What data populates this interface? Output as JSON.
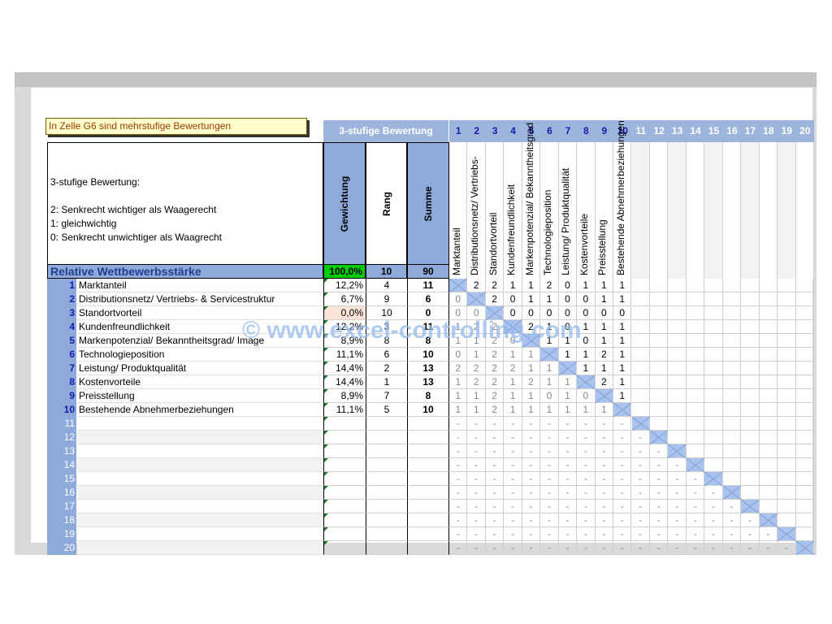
{
  "note": "In Zelle G6 sind mehrstufige Bewertungen",
  "header_label": "3-stufige Bewertung",
  "info_lines": [
    "3-stufige Bewertung:",
    "",
    "2: Senkrecht wichtiger als Waagerecht",
    "1: gleichwichtig",
    "0: Senkrecht unwichtiger als Waagrecht"
  ],
  "col_headers": {
    "weight": "Gewichtung",
    "rank": "Rang",
    "sum": "Summe"
  },
  "relative": {
    "label": "Relative Wettbewerbsstärke",
    "weight": "100,0%",
    "rank": "10",
    "sum": "90"
  },
  "matrix_col_numbers": [
    "1",
    "2",
    "3",
    "4",
    "5",
    "6",
    "7",
    "8",
    "9",
    "10",
    "11",
    "12",
    "13",
    "14",
    "15",
    "16",
    "17",
    "18",
    "19",
    "20"
  ],
  "matrix_col_titles": [
    "Marktanteil",
    "Distributionsnetz/ Vertriebs-",
    "Standortvorteil",
    "Kundenfreundlichkeit",
    "Markenpotenzial/ Bekanntheitsgrad",
    "Technologieposition",
    "Leistung/ Produktqualität",
    "Kostenvorteile",
    "Preisstellung",
    "Bestehende Abnehmerbeziehungen",
    "",
    "",
    "",
    "",
    "",
    "",
    "",
    "",
    "",
    ""
  ],
  "rows": [
    {
      "num": "1",
      "name": "Marktanteil",
      "weight": "12,2%",
      "rank": "4",
      "sum": "11",
      "vals": [
        "x",
        "2",
        "2",
        "1",
        "1",
        "2",
        "0",
        "1",
        "1",
        "1"
      ]
    },
    {
      "num": "2",
      "name": "Distributionsnetz/ Vertriebs- & Servicestruktur",
      "weight": "6,7%",
      "rank": "9",
      "sum": "6",
      "vals": [
        "0",
        "x",
        "2",
        "0",
        "1",
        "1",
        "0",
        "0",
        "1",
        "1"
      ]
    },
    {
      "num": "3",
      "name": "Standortvorteil",
      "weight": "0,0%",
      "rank": "10",
      "sum": "0",
      "vals": [
        "0",
        "0",
        "x",
        "0",
        "0",
        "0",
        "0",
        "0",
        "0",
        "0"
      ]
    },
    {
      "num": "4",
      "name": "Kundenfreundlichkeit",
      "weight": "12,2%",
      "rank": "3",
      "sum": "11",
      "vals": [
        "1",
        "2",
        "2",
        "x",
        "2",
        "1",
        "0",
        "1",
        "1",
        "1"
      ]
    },
    {
      "num": "5",
      "name": "Markenpotenzial/ Bekanntheitsgrad/ Image",
      "weight": "8,9%",
      "rank": "8",
      "sum": "8",
      "vals": [
        "1",
        "1",
        "2",
        "0",
        "x",
        "1",
        "1",
        "0",
        "1",
        "1"
      ]
    },
    {
      "num": "6",
      "name": "Technologieposition",
      "weight": "11,1%",
      "rank": "6",
      "sum": "10",
      "vals": [
        "0",
        "1",
        "2",
        "1",
        "1",
        "x",
        "1",
        "1",
        "2",
        "1"
      ]
    },
    {
      "num": "7",
      "name": "Leistung/ Produktqualität",
      "weight": "14,4%",
      "rank": "2",
      "sum": "13",
      "vals": [
        "2",
        "2",
        "2",
        "2",
        "1",
        "1",
        "x",
        "1",
        "1",
        "1"
      ]
    },
    {
      "num": "8",
      "name": "Kostenvorteile",
      "weight": "14,4%",
      "rank": "1",
      "sum": "13",
      "vals": [
        "1",
        "2",
        "2",
        "1",
        "2",
        "1",
        "1",
        "x",
        "2",
        "1"
      ]
    },
    {
      "num": "9",
      "name": "Preisstellung",
      "weight": "8,9%",
      "rank": "7",
      "sum": "8",
      "vals": [
        "1",
        "1",
        "2",
        "1",
        "1",
        "0",
        "1",
        "0",
        "x",
        "1"
      ]
    },
    {
      "num": "10",
      "name": "Bestehende Abnehmerbeziehungen",
      "weight": "11,1%",
      "rank": "5",
      "sum": "10",
      "vals": [
        "1",
        "1",
        "2",
        "1",
        "1",
        "1",
        "1",
        "1",
        "1",
        "x"
      ]
    },
    {
      "num": "11",
      "name": "",
      "weight": "",
      "rank": "",
      "sum": "",
      "vals": []
    },
    {
      "num": "12",
      "name": "",
      "weight": "",
      "rank": "",
      "sum": "",
      "vals": []
    },
    {
      "num": "13",
      "name": "",
      "weight": "",
      "rank": "",
      "sum": "",
      "vals": []
    },
    {
      "num": "14",
      "name": "",
      "weight": "",
      "rank": "",
      "sum": "",
      "vals": []
    },
    {
      "num": "15",
      "name": "",
      "weight": "",
      "rank": "",
      "sum": "",
      "vals": []
    },
    {
      "num": "16",
      "name": "",
      "weight": "",
      "rank": "",
      "sum": "",
      "vals": []
    },
    {
      "num": "17",
      "name": "",
      "weight": "",
      "rank": "",
      "sum": "",
      "vals": []
    },
    {
      "num": "18",
      "name": "",
      "weight": "",
      "rank": "",
      "sum": "",
      "vals": []
    },
    {
      "num": "19",
      "name": "",
      "weight": "",
      "rank": "",
      "sum": "",
      "vals": []
    },
    {
      "num": "20",
      "name": "",
      "weight": "",
      "rank": "",
      "sum": "",
      "vals": []
    }
  ],
  "dash": "-",
  "watermark": "© www.excel-controlling.com",
  "colors": {
    "header_blue": "#8eaadb",
    "diag": "#a9c3ee",
    "green": "#00cc00",
    "num_blue": "#1a1aaa"
  }
}
